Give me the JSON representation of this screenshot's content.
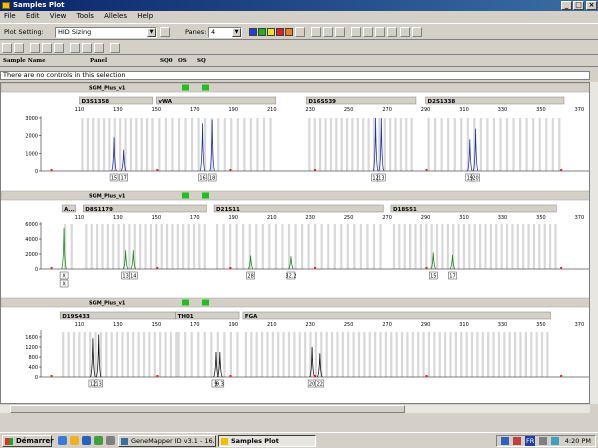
{
  "window": {
    "title": "Samples Plot",
    "controls": [
      "_",
      "□",
      "×"
    ]
  },
  "menu": [
    "File",
    "Edit",
    "View",
    "Tools",
    "Alleles",
    "Help"
  ],
  "toolbar": {
    "plot_setting_label": "Plot Setting:",
    "plot_setting_value": "HID Sizing",
    "panes_label": "Panes:",
    "panes_value": "4"
  },
  "columns": {
    "sample_name": "Sample Name",
    "panel": "Panel",
    "sq0": "SQ0",
    "os": "OS",
    "sq": "SQ"
  },
  "notice": "There are no controls in this selection",
  "panes": [
    {
      "sample": "SGM_Plus_v1",
      "color": "#1f2faa",
      "ylim": [
        0,
        3000
      ],
      "yticks": [
        0,
        1000,
        2000,
        3000
      ],
      "loci": [
        {
          "name": "D3S1358",
          "start": 110,
          "end": 148
        },
        {
          "name": "vWA",
          "start": 150,
          "end": 212
        },
        {
          "name": "D16S539",
          "start": 228,
          "end": 285
        },
        {
          "name": "D2S1338",
          "start": 290,
          "end": 362
        }
      ],
      "peaks": [
        {
          "x": 128,
          "h": 1900,
          "label": "15"
        },
        {
          "x": 133,
          "h": 1200,
          "label": "17"
        },
        {
          "x": 174,
          "h": 2700,
          "label": "16"
        },
        {
          "x": 179,
          "h": 2900,
          "label": "18"
        },
        {
          "x": 264,
          "h": 3000,
          "label": "12"
        },
        {
          "x": 267,
          "h": 3000,
          "label": "13"
        },
        {
          "x": 313,
          "h": 1800,
          "label": "19"
        },
        {
          "x": 316,
          "h": 2400,
          "label": "20"
        }
      ]
    },
    {
      "sample": "SGM_Plus_v1",
      "color": "#1a8a1a",
      "ylim": [
        0,
        6000
      ],
      "yticks": [
        0,
        2000,
        4000,
        6000
      ],
      "loci": [
        {
          "name": "A...",
          "start": 101,
          "end": 108
        },
        {
          "name": "D8S1179",
          "start": 112,
          "end": 176
        },
        {
          "name": "D21S11",
          "start": 180,
          "end": 268
        },
        {
          "name": "D18S51",
          "start": 272,
          "end": 358
        }
      ],
      "peaks": [
        {
          "x": 102,
          "h": 5500,
          "label": "X"
        },
        {
          "x": 134,
          "h": 2500,
          "label": "13"
        },
        {
          "x": 138,
          "h": 2500,
          "label": "14"
        },
        {
          "x": 199,
          "h": 1800,
          "label": "28"
        },
        {
          "x": 220,
          "h": 1700,
          "label": "32.2"
        },
        {
          "x": 294,
          "h": 2200,
          "label": "15"
        },
        {
          "x": 304,
          "h": 1900,
          "label": "17"
        }
      ],
      "extra_labels": [
        {
          "x": 102,
          "label": "X"
        }
      ]
    },
    {
      "sample": "SGM_Plus_v1",
      "color": "#101010",
      "ylim": [
        0,
        1800
      ],
      "yticks": [
        0,
        400,
        800,
        1200,
        1600
      ],
      "loci": [
        {
          "name": "D19S433",
          "start": 100,
          "end": 160
        },
        {
          "name": "TH01",
          "start": 160,
          "end": 193
        },
        {
          "name": "FGA",
          "start": 195,
          "end": 355
        }
      ],
      "peaks": [
        {
          "x": 117,
          "h": 1550,
          "label": "12"
        },
        {
          "x": 120,
          "h": 1700,
          "label": "13"
        },
        {
          "x": 181,
          "h": 1000,
          "label": "9"
        },
        {
          "x": 183,
          "h": 1000,
          "label": "9.3"
        },
        {
          "x": 231,
          "h": 1200,
          "label": "20"
        },
        {
          "x": 235,
          "h": 950,
          "label": "22"
        }
      ]
    }
  ],
  "x_axis": {
    "min": 90,
    "max": 375,
    "ticks": [
      110,
      130,
      150,
      170,
      190,
      210,
      230,
      250,
      270,
      290,
      310,
      330,
      350,
      370
    ]
  },
  "taskbar": {
    "start_label": "Démarrer",
    "tasks": [
      "GeneMapper ID v3.1 - 16...",
      "Samples Plot"
    ],
    "tray_lang": "FR",
    "clock": "4:20 PM"
  }
}
